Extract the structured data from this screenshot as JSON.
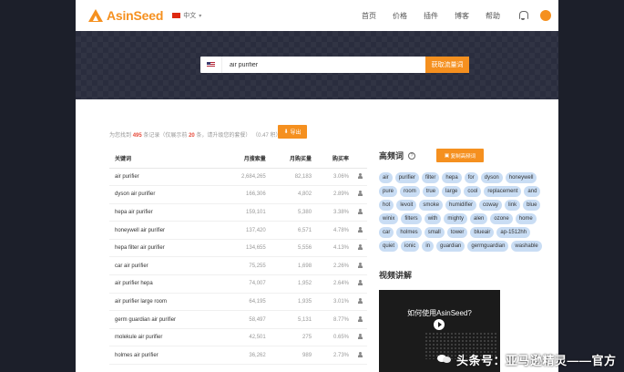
{
  "brand": {
    "name": "AsinSeed"
  },
  "language": {
    "selected": "中文"
  },
  "nav": [
    "首页",
    "价格",
    "插件",
    "博客",
    "帮助"
  ],
  "search": {
    "value": "air purifier",
    "button": "获取流量词"
  },
  "stats": {
    "prefix": "为您找到",
    "count": "495",
    "mid": "条记录（仅展示前",
    "shown": "20",
    "suffix": "条，请升级您的套餐）",
    "credits": "（0.47 积）"
  },
  "export_button": "导出",
  "table": {
    "headers": [
      "关键词",
      "月搜索量",
      "月购买量",
      "购买率"
    ],
    "rows": [
      [
        "air purifier",
        "2,684,265",
        "82,183",
        "3.06%"
      ],
      [
        "dyson air purifier",
        "166,306",
        "4,802",
        "2.89%"
      ],
      [
        "hepa air purifier",
        "159,101",
        "5,380",
        "3.38%"
      ],
      [
        "honeywell air purifier",
        "137,420",
        "6,571",
        "4.78%"
      ],
      [
        "hepa filter air purifier",
        "134,655",
        "5,556",
        "4.13%"
      ],
      [
        "car air purifier",
        "75,255",
        "1,698",
        "2.26%"
      ],
      [
        "air purifier hepa",
        "74,007",
        "1,952",
        "2.64%"
      ],
      [
        "air purifier large room",
        "64,195",
        "1,935",
        "3.01%"
      ],
      [
        "germ guardian air purifier",
        "58,497",
        "5,131",
        "8.77%"
      ],
      [
        "molekule air purifier",
        "42,501",
        "275",
        "0.65%"
      ],
      [
        "holmes air purifier",
        "36,262",
        "989",
        "2.73%"
      ]
    ]
  },
  "high_freq": {
    "title": "高频词",
    "copy_button": "复制高频词",
    "tags": [
      "air",
      "purifier",
      "filter",
      "hepa",
      "for",
      "dyson",
      "honeywell",
      "pure",
      "room",
      "true",
      "large",
      "cool",
      "replacement",
      "and",
      "hot",
      "levoit",
      "smoke",
      "humidifier",
      "coway",
      "link",
      "blue",
      "winix",
      "filters",
      "with",
      "mighty",
      "alen",
      "ozone",
      "home",
      "car",
      "holmes",
      "small",
      "tower",
      "blueair",
      "ap-1512hh",
      "quiet",
      "ionic",
      "in",
      "guardian",
      "germguardian",
      "washable"
    ]
  },
  "video": {
    "section_title": "视频讲解",
    "title": "如何使用AsinSeed?"
  },
  "watermark": "头条号：亚马逊精灵——官方",
  "colors": {
    "accent": "#f5901f",
    "tag_bg": "#c9ddf4",
    "hero_bg": "#2a2d3e"
  }
}
